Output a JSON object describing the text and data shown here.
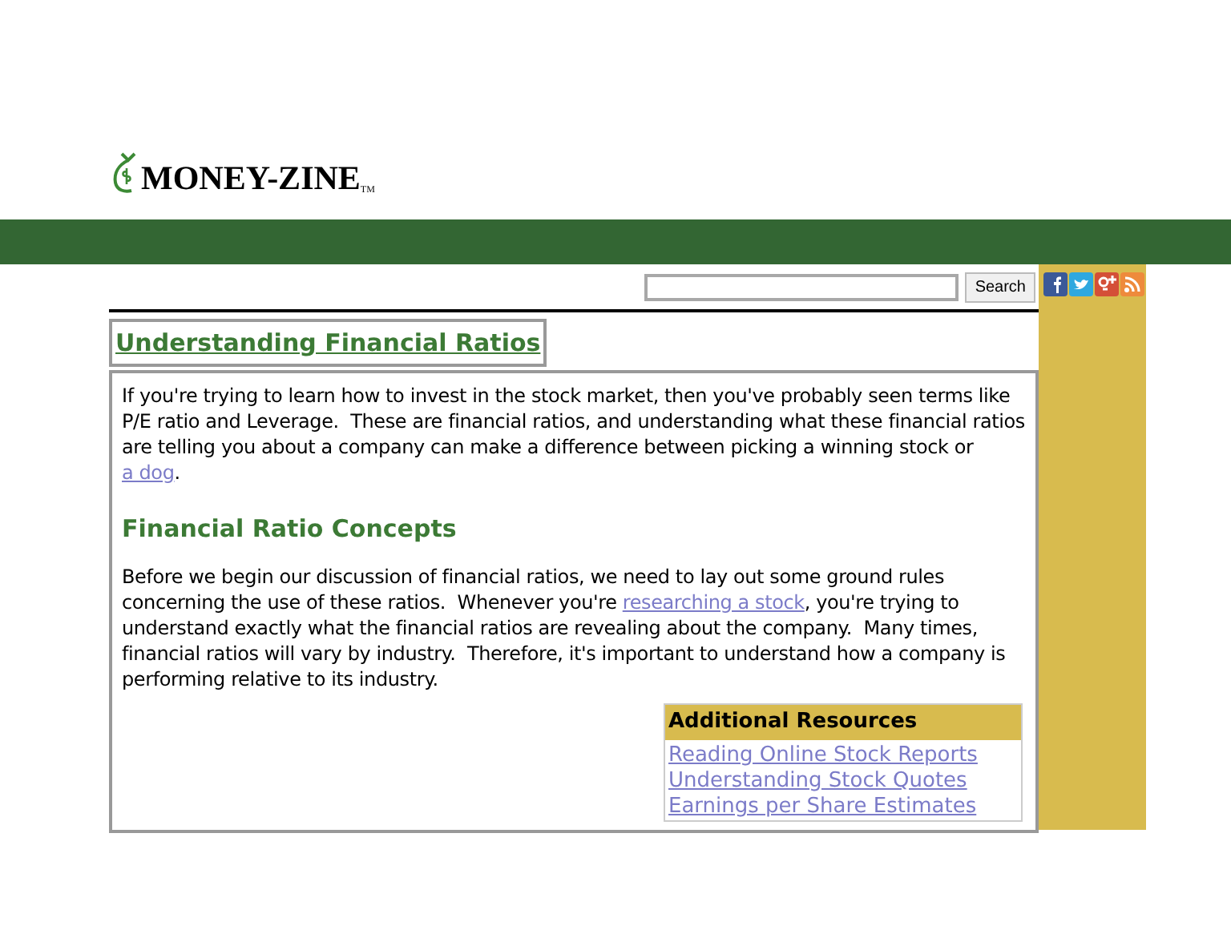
{
  "logo": {
    "name": "MONEY-ZINE",
    "trademark": "TM"
  },
  "search": {
    "button": "Search"
  },
  "article": {
    "title": "Understanding Financial Ratios",
    "paragraphs": [
      {
        "kind": "text",
        "parts": [
          {
            "text": "If you're trying to learn how to invest in the stock market, then you've probably seen terms like P/E ratio and Leverage.  These are financial ratios, and understanding what these financial ratios are telling you about a company can make a difference between picking a winning stock or "
          },
          {
            "text": "a dog",
            "link": true
          },
          {
            "text": "."
          }
        ]
      },
      {
        "kind": "heading",
        "parts": [
          {
            "text": "Financial Ratio Concepts"
          }
        ]
      },
      {
        "kind": "text",
        "parts": [
          {
            "text": "Before we begin our discussion of financial ratios, we need to lay out some ground rules concerning the use of these ratios.  Whenever you're "
          },
          {
            "text": "researching a stock",
            "link": true
          },
          {
            "text": ", you're trying to understand exactly what the financial ratios are revealing about the company.  Many times, financial ratios will vary by industry.  Therefore, it's important to understand how a company is performing relative to its industry."
          }
        ]
      }
    ]
  },
  "resources": {
    "title": "Additional Resources",
    "links": [
      "Reading Online Stock Reports",
      "Understanding Stock Quotes",
      "Earnings per Share Estimates"
    ]
  }
}
